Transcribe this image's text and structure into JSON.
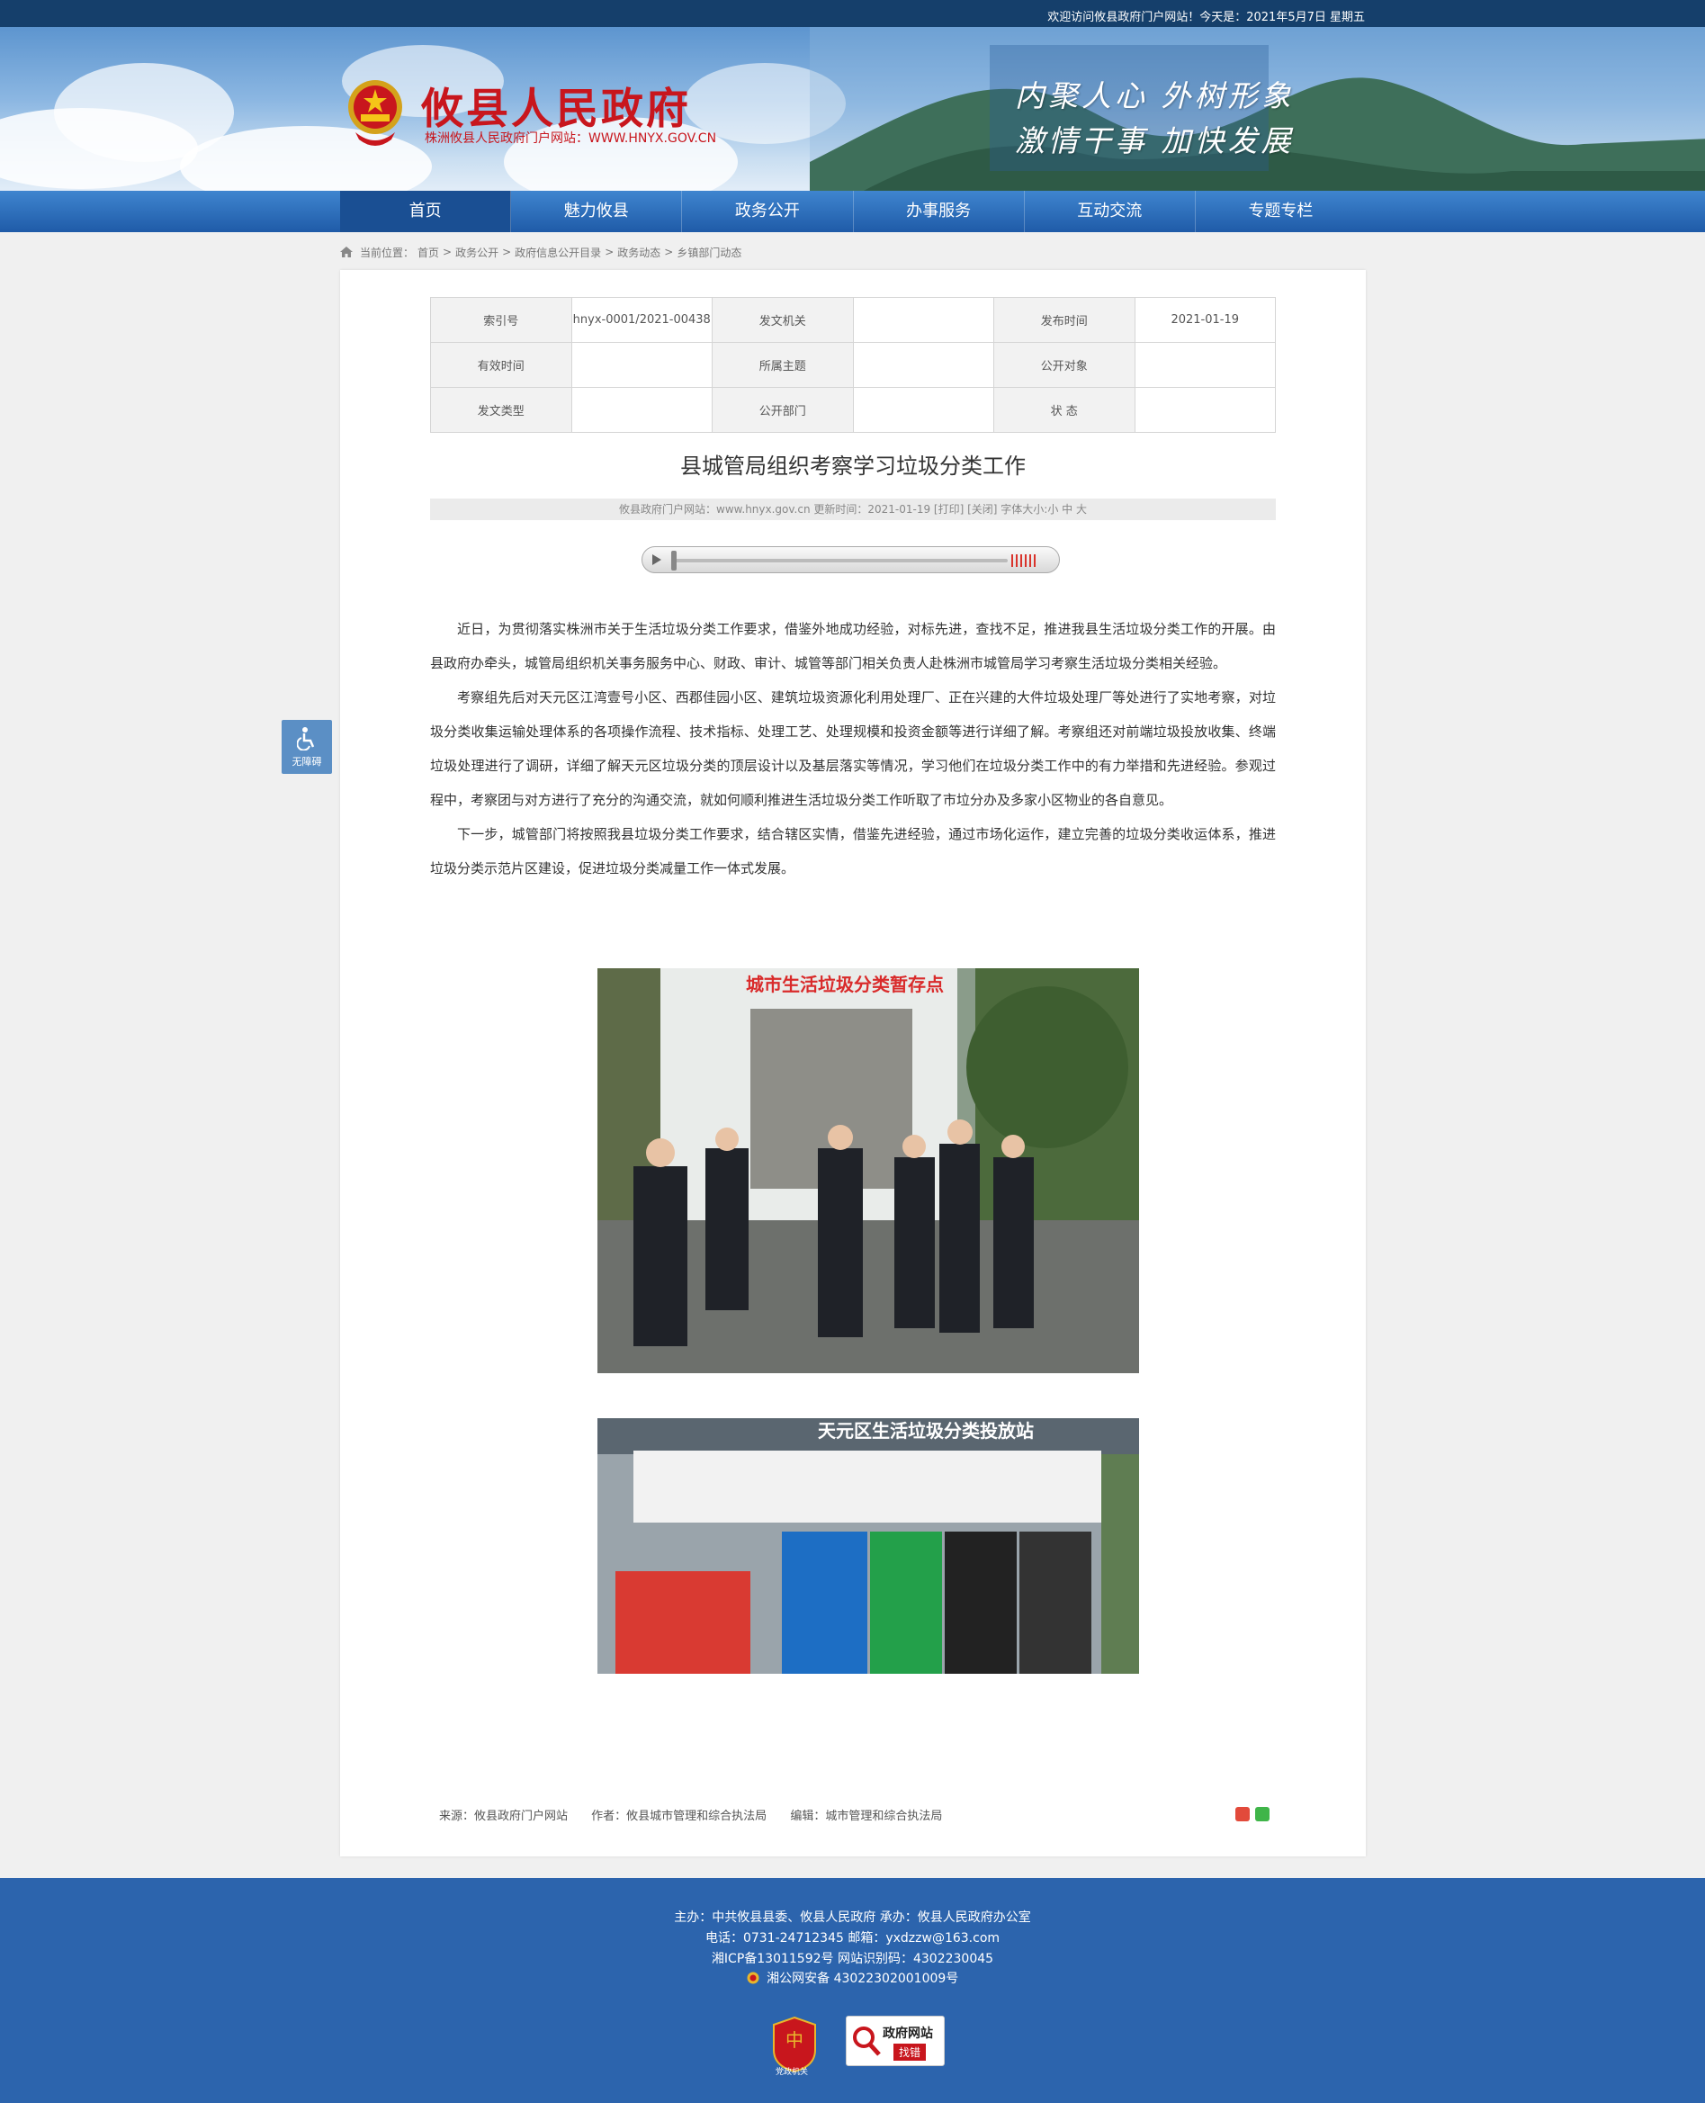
{
  "topbar": {
    "welcome": "欢迎访问攸县政府门户网站！今天是：2021年5月7日 星期五"
  },
  "header": {
    "title": "攸县人民政府",
    "subtitle": "株洲攸县人民政府门户网站：WWW.HNYX.GOV.CN",
    "slogan_line1": "内聚人心  外树形象",
    "slogan_line2": "激情干事  加快发展",
    "emblem_icon": "national-emblem-icon"
  },
  "nav": [
    {
      "label": "首页",
      "active": true
    },
    {
      "label": "魅力攸县"
    },
    {
      "label": "政务公开"
    },
    {
      "label": "办事服务"
    },
    {
      "label": "互动交流"
    },
    {
      "label": "专题专栏"
    }
  ],
  "breadcrumb": {
    "prefix": "当前位置：",
    "items": [
      "首页",
      ">",
      "政务公开",
      ">",
      "政府信息公开目录",
      ">",
      "政务动态",
      ">",
      "乡镇部门动态"
    ]
  },
  "meta": {
    "index_label": "索引号",
    "index_value": "hnyx-0001/2021-00438",
    "issuer_label": "发文机关",
    "issuer_value": "",
    "pubdate_label": "发布时间",
    "pubdate_value": "2021-01-19",
    "valid_label": "有效时间",
    "valid_value": "",
    "topic_label": "所属主题",
    "topic_value": "",
    "audience_label": "公开对象",
    "audience_value": "",
    "doctype_label": "发文类型",
    "doctype_value": "",
    "dept_label": "公开部门",
    "dept_value": "",
    "status_label": "状 态",
    "status_value": ""
  },
  "article": {
    "title": "县城管局组织考察学习垃圾分类工作",
    "info": "攸县政府门户网站：www.hnyx.gov.cn   更新时间：2021-01-19   [打印] [关闭]   字体大小:小 中 大",
    "paragraphs": [
      "近日，为贯彻落实株洲市关于生活垃圾分类工作要求，借鉴外地成功经验，对标先进，查找不足，推进我县生活垃圾分类工作的开展。由县政府办牵头，城管局组织机关事务服务中心、财政、审计、城管等部门相关负责人赴株洲市城管局学习考察生活垃圾分类相关经验。",
      "考察组先后对天元区江湾壹号小区、西郡佳园小区、建筑垃圾资源化利用处理厂、正在兴建的大件垃圾处理厂等处进行了实地考察，对垃圾分类收集运输处理体系的各项操作流程、技术指标、处理工艺、处理规模和投资金额等进行详细了解。考察组还对前端垃圾投放收集、终端垃圾处理进行了调研，详细了解天元区垃圾分类的顶层设计以及基层落实等情况，学习他们在垃圾分类工作中的有力举措和先进经验。参观过程中，考察团与对方进行了充分的沟通交流，就如何顺利推进生活垃圾分类工作听取了市垃分办及多家小区物业的各自意见。",
      "  下一步，城管部门将按照我县垃圾分类工作要求，结合辖区实情，借鉴先进经验，通过市场化运作，建立完善的垃圾分类收运体系，推进垃圾分类示范片区建设，促进垃圾分类减量工作一体式发展。"
    ],
    "photo1_sign": "城市生活垃圾分类暂存点",
    "photo2_sign": "天元区生活垃圾分类投放站",
    "source": "来源：攸县政府门户网站",
    "author": "作者：攸县城市管理和综合执法局",
    "editor": "编辑：城市管理和综合执法局"
  },
  "accessibility": {
    "label": "无障碍"
  },
  "footer": {
    "line1": "主办：中共攸县县委、攸县人民政府 承办：攸县人民政府办公室",
    "line2": "电话：0731-24712345 邮箱：yxdzzw@163.com",
    "line3": "湘ICP备13011592号   网站识别码：4302230045",
    "line4": "湘公网安备 43022302001009号",
    "badge_label": "党政机关",
    "badge2_line1": "政府网站",
    "badge2_line2": "找错"
  },
  "colors": {
    "brand_red": "#c8161d",
    "nav_blue": "#2c64ad",
    "footer_blue": "#2c64ad"
  }
}
